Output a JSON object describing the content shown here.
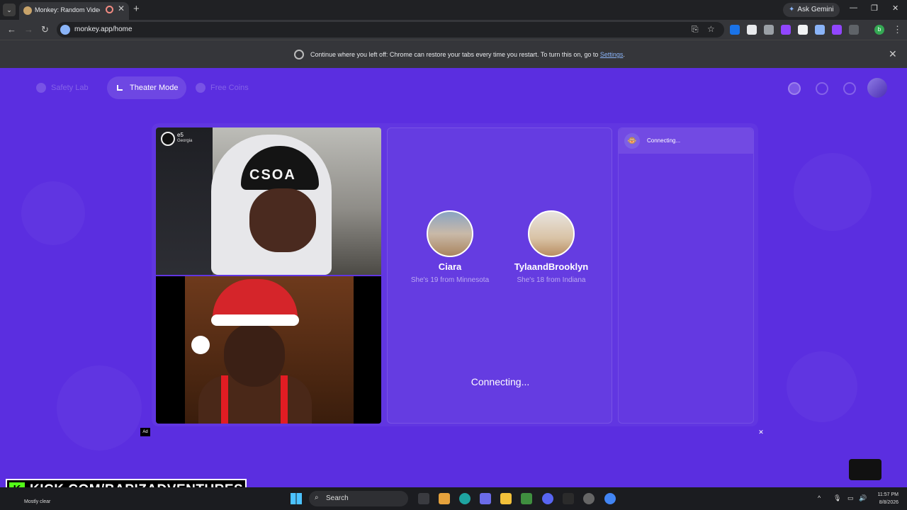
{
  "browser": {
    "tab_title": "Monkey: Random Video Ch",
    "url": "monkey.app/home",
    "ask_gemini": "Ask Gemini",
    "restore_bar": {
      "text": "Continue where you left off: Chrome can restore your tabs every time you restart. To turn this on, go to",
      "link": "Settings",
      "suffix": "."
    },
    "profile_initial": "b"
  },
  "nav": {
    "safety_lab": "Safety Lab",
    "theater_mode": "Theater Mode",
    "free_coins": "Free Coins"
  },
  "self_cam": {
    "name": "e5",
    "location": "Georgia",
    "hat_text": "CSOA"
  },
  "matches": [
    {
      "name": "Ciara",
      "desc": "She's 19 from Minnesota"
    },
    {
      "name": "TylaandBrooklyn",
      "desc": "She's 18 from Indiana"
    }
  ],
  "status_main": "Connecting...",
  "chat": {
    "status": "Connecting..."
  },
  "ad_label": "Ad",
  "overlay": {
    "kick_logo": "K",
    "kick_url": "KICK.COM/BAPIZADVENTURES"
  },
  "taskbar": {
    "weather": "Mostly clear",
    "search": "Search",
    "time": "11:57 PM",
    "date": "8/8/2026"
  }
}
